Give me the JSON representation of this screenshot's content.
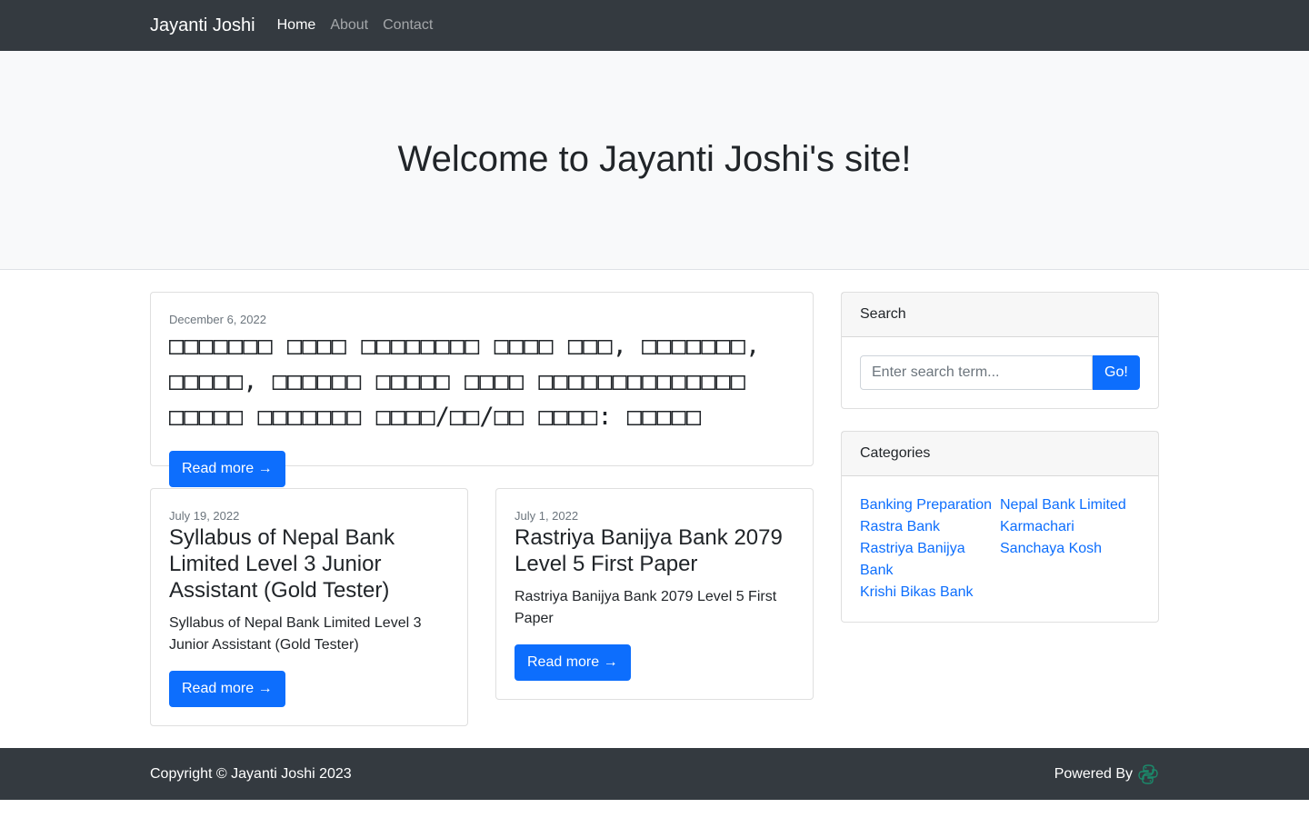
{
  "navbar": {
    "brand": "Jayanti Joshi",
    "links": [
      {
        "label": "Home",
        "active": true
      },
      {
        "label": "About",
        "active": false
      },
      {
        "label": "Contact",
        "active": false
      }
    ]
  },
  "hero": {
    "title": "Welcome to Jayanti Joshi's site!"
  },
  "featured_post": {
    "date": "December 6, 2022",
    "title": "□□□□□□□ □□□□ □□□□□□□□ □□□□ □□□, □□□□□□□, □□□□□, □□□□□□ □□□□□ □□□□ □□□□□□□□□□□□□□ □□□□□ □□□□□□□ □□□□/□□/□□ □□□□: □□□□□",
    "button": "Read more →"
  },
  "posts": [
    {
      "date": "July 19, 2022",
      "title": "Syllabus of Nepal Bank Limited Level 3 Junior Assistant (Gold Tester)",
      "excerpt": "Syllabus of Nepal Bank Limited Level 3 Junior Assistant (Gold Tester)",
      "button": "Read more →"
    },
    {
      "date": "July 1, 2022",
      "title": "Rastriya Banijya Bank 2079 Level 5 First Paper",
      "excerpt": "Rastriya Banijya Bank 2079 Level 5 First Paper",
      "button": "Read more →"
    }
  ],
  "search": {
    "header": "Search",
    "placeholder": "Enter search term...",
    "button": "Go!"
  },
  "categories": {
    "header": "Categories",
    "left": [
      "Banking Preparation",
      "Rastra Bank",
      "Rastriya Banijya Bank",
      "Krishi Bikas Bank"
    ],
    "right": [
      "Nepal Bank Limited",
      "Karmachari Sanchaya Kosh"
    ]
  },
  "footer": {
    "copyright": "Copyright © Jayanti Joshi 2023",
    "powered_by": "Powered By",
    "logo_icon": "python-logo-icon"
  },
  "colors": {
    "navbar_bg": "#343a40",
    "accent": "#0d6efd",
    "hero_bg": "#f8f9fa"
  }
}
